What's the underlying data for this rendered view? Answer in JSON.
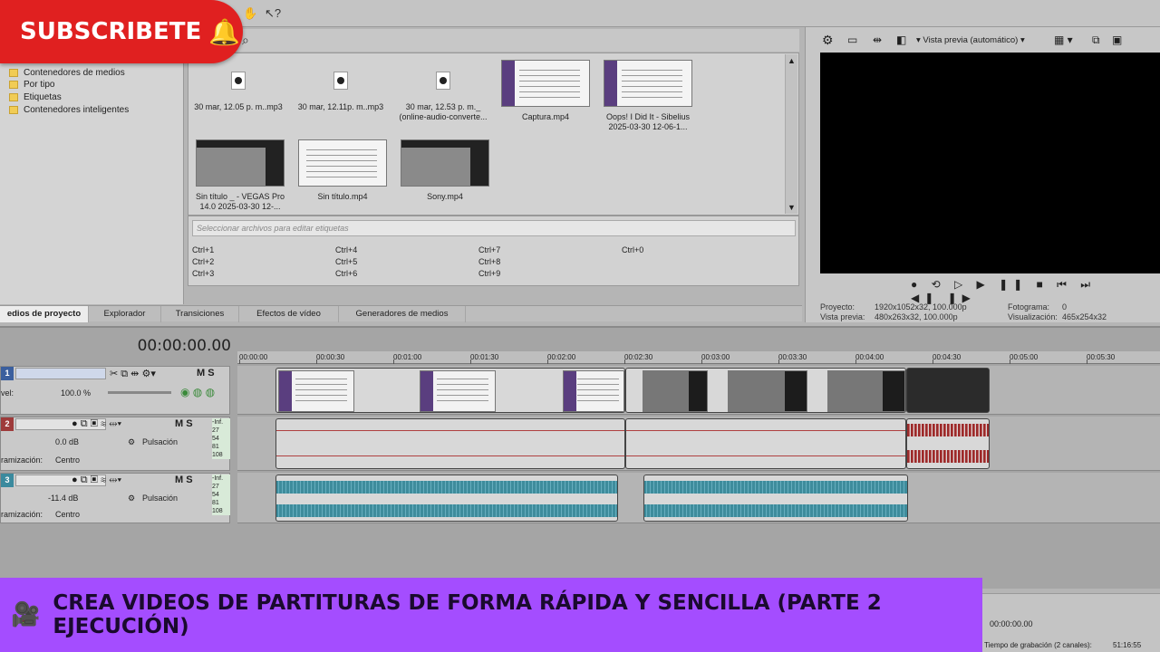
{
  "subscribe": {
    "label": "SUBSCRIBETE",
    "bell": "🔔",
    "color": "#e02020"
  },
  "tree": {
    "items": [
      "Contenedores de medios",
      "Por tipo",
      "Etiquetas",
      "Contenedores inteligentes"
    ]
  },
  "media": {
    "items": [
      {
        "label": "30 mar, 12.05 p. m..mp3",
        "kind": "mp3"
      },
      {
        "label": "30 mar, 12.11p. m..mp3",
        "kind": "mp3"
      },
      {
        "label": "30 mar, 12.53 p. m._ (online-audio-converte...",
        "kind": "mp3"
      },
      {
        "label": "Captura.mp4",
        "kind": "score"
      },
      {
        "label": "Oops! I Did It - Sibelius 2025-03-30 12-06-1...",
        "kind": "score"
      },
      {
        "label": "Sin título _ - VEGAS Pro 14.0 2025-03-30 12-...",
        "kind": "screen"
      },
      {
        "label": "Sin título.mp4",
        "kind": "score-white"
      },
      {
        "label": "Sony.mp4",
        "kind": "screen"
      }
    ]
  },
  "tags": {
    "placeholder": "Seleccionar archivos para editar etiquetas",
    "shortcuts": [
      "Ctrl+1",
      "Ctrl+2",
      "Ctrl+3",
      "Ctrl+4",
      "Ctrl+5",
      "Ctrl+6",
      "Ctrl+7",
      "Ctrl+8",
      "Ctrl+9",
      "Ctrl+0"
    ]
  },
  "tabs": [
    "edios de proyecto",
    "Explorador",
    "Transiciones",
    "Efectos de vídeo",
    "Generadores de medios"
  ],
  "preview": {
    "mode": "Vista previa (automático)",
    "proyecto_label": "Proyecto:",
    "proyecto_value": "1920x1052x32, 100.000p",
    "vista_label": "Vista previa:",
    "vista_value": "480x263x32, 100.000p",
    "fotograma_label": "Fotograma:",
    "fotograma_value": "0",
    "visualizacion_label": "Visualización:",
    "visualizacion_value": "465x254x32",
    "transport": "● ⟲ ▷ ▶ ❚❚ ■ ⏮ ⏭ ◀❚ ❚▶"
  },
  "timeline": {
    "timecode": "00:00:00.00",
    "ruler": [
      "00:00:00",
      "00:00:30",
      "00:01:00",
      "00:01:30",
      "00:02:00",
      "00:02:30",
      "00:03:00",
      "00:03:30",
      "00:04:00",
      "00:04:30",
      "00:05:00",
      "00:05:30"
    ],
    "tracks": [
      {
        "num": "1",
        "level_label": "vel:",
        "level_value": "100.0 %"
      },
      {
        "num": "2",
        "db": "0.0 dB",
        "mode": "Pulsación",
        "pan_label": "ramización:",
        "pan_value": "Centro",
        "meter": [
          "-Inf.",
          "27",
          "54",
          "81",
          "108"
        ]
      },
      {
        "num": "3",
        "db": "-11.4 dB",
        "mode": "Pulsación",
        "pan_label": "ramización:",
        "pan_value": "Centro",
        "meter": [
          "-Inf.",
          "27",
          "54",
          "81",
          "108"
        ]
      }
    ],
    "track_buttons": "M S"
  },
  "status": {
    "time": "00:00:00.00",
    "record_label": "Tiempo de grabación (2 canales):",
    "record_value": "51:16:55"
  },
  "banner": {
    "text": "CREA VIDEOS DE PARTITURAS DE FORMA RÁPIDA Y SENCILLA (PARTE 2 EJECUCIÓN)",
    "color": "#a44dff"
  }
}
